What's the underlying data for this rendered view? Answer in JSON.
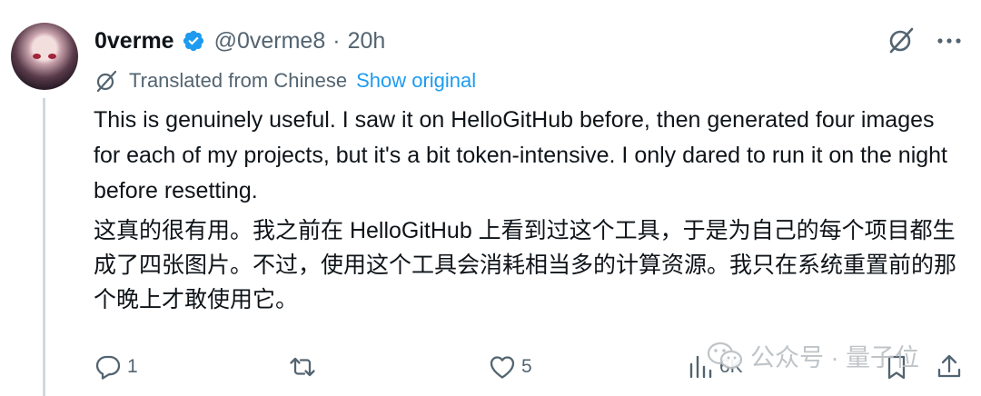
{
  "tweet": {
    "display_name": "0verme",
    "handle": "@0verme8",
    "separator": "·",
    "time": "20h",
    "translation_label": "Translated from Chinese",
    "show_original_label": "Show original",
    "text_en": "This is genuinely useful. I saw it on HelloGitHub before, then generated four images for each of my projects, but it's a bit token-intensive. I only dared to run it on the night before resetting.",
    "text_zh": "这真的很有用。我之前在 HelloGitHub 上看到过这个工具，于是为自己的每个项目都生成了四张图片。不过，使用这个工具会消耗相当多的计算资源。我只在系统重置前的那个晚上才敢使用它。"
  },
  "actions": {
    "reply_count": "1",
    "retweet_count": "",
    "like_count": "5",
    "view_count": "6K"
  },
  "watermark": {
    "text": "公众号 · 量子位"
  },
  "colors": {
    "text": "#0f1419",
    "muted": "#536471",
    "link": "#1d9bf0",
    "verified": "#1d9bf0",
    "thread_line": "#cfd9de"
  }
}
